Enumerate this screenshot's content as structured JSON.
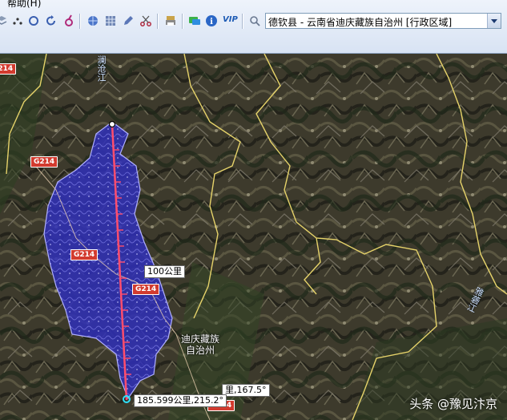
{
  "menu": {
    "help": "帮助(H)"
  },
  "toolbar": {
    "vip_label": "VIP",
    "icons": [
      "layers-icon",
      "circle-refresh-icon",
      "rotate-icon",
      "pin-icon",
      "globe-icon",
      "grid-icon",
      "pencil-icon",
      "scissors-icon",
      "printer-icon",
      "message-icon",
      "info-icon",
      "search-icon"
    ]
  },
  "region_select": {
    "value": "德钦县 - 云南省迪庆藏族自治州 [行政区域]"
  },
  "map": {
    "road_labels": [
      "G214",
      "G214",
      "G214",
      "G214",
      "G214"
    ],
    "region_label_line1": "迪庆藏族",
    "region_label_line2": "自治州",
    "river_left": "澜沧江",
    "river_right": "雅砻江",
    "scale_mark": "100公里",
    "measure_result": "185.599公里,215.2°",
    "measure_bearing": "里,167.5°"
  },
  "colors": {
    "region_fill": "#3a3ad0",
    "measure_line": "#ff4d6d",
    "boundary": "#e6d36a",
    "road_badge": "#d23b2f"
  },
  "watermark": "头条 @豫见汴京"
}
